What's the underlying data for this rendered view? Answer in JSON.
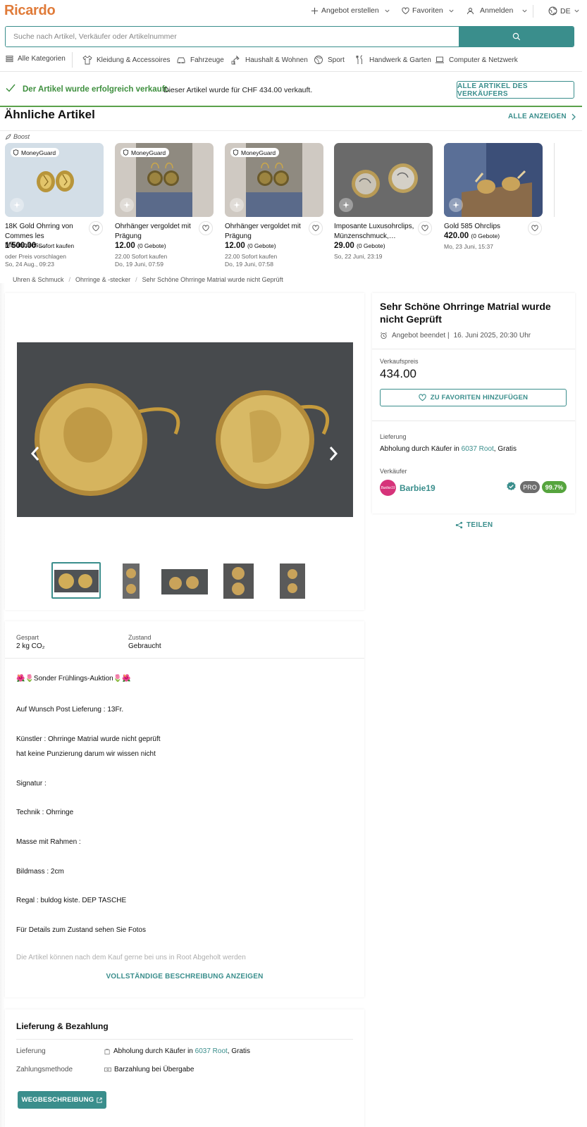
{
  "header": {
    "logo": "Ricardo",
    "create_offer": "Angebot erstellen",
    "favorites": "Favoriten",
    "login": "Anmelden",
    "language": "DE"
  },
  "search": {
    "placeholder": "Suche nach Artikel, Verkäufer oder Artikelnummer"
  },
  "categories": [
    {
      "label": "Alle Kategorien",
      "icon": "menu-icon"
    },
    {
      "label": "Kleidung & Accessoires",
      "icon": "shirt-icon"
    },
    {
      "label": "Fahrzeuge",
      "icon": "car-icon"
    },
    {
      "label": "Haushalt & Wohnen",
      "icon": "lamp-icon"
    },
    {
      "label": "Sport",
      "icon": "ball-icon"
    },
    {
      "label": "Handwerk & Garten",
      "icon": "tools-icon"
    },
    {
      "label": "Computer & Netzwerk",
      "icon": "laptop-icon"
    }
  ],
  "sold_banner": {
    "title": "Der Artikel wurde erfolgreich verkauft.",
    "text": "Dieser Artikel wurde für CHF 434.00 verkauft.",
    "button": "ALLE ARTIKEL DES VERKÄUFERS",
    "color": "#3e8f3e"
  },
  "similar": {
    "title": "Ähnliche Artikel",
    "show_all": "ALLE ANZEIGEN",
    "boost": "Boost",
    "cards": [
      {
        "badge": "MoneyGuard",
        "title": "18K Gold Ohrring von Commes les Milionaires…",
        "price": "1'500.00",
        "price_suffix": "Sofort kaufen",
        "meta1": "oder Preis vorschlagen",
        "meta2": "So, 24 Aug., 09:23"
      },
      {
        "badge": "MoneyGuard",
        "title": "Ohrhänger vergoldet mit Prägung",
        "price": "12.00",
        "price_suffix": "(0 Gebote)",
        "meta1": "22.00 Sofort kaufen",
        "meta2": "Do, 19 Juni, 07:59"
      },
      {
        "badge": "MoneyGuard",
        "title": "Ohrhänger vergoldet mit Prägung",
        "price": "12.00",
        "price_suffix": "(0 Gebote)",
        "meta1": "22.00 Sofort kaufen",
        "meta2": "Do, 19 Juni, 07:58"
      },
      {
        "badge": "",
        "title": "Imposante Luxusohrclips, Münzenschmuck,…",
        "price": "29.00",
        "price_suffix": "(0 Gebote)",
        "meta1": "So, 22 Juni, 23:19",
        "meta2": ""
      },
      {
        "badge": "",
        "title": "Gold 585 Ohrclips",
        "price": "420.00",
        "price_suffix": "(0 Gebote)",
        "meta1": "Mo, 23 Juni, 15:37",
        "meta2": ""
      }
    ]
  },
  "breadcrumb": [
    "Uhren & Schmuck",
    "Ohrringe & -stecker",
    "Sehr Schöne Ohrringe Matrial wurde nicht Geprüft"
  ],
  "item": {
    "title": "Sehr Schöne Ohrringe Matrial wurde nicht Geprüft",
    "ended_label": "Angebot beendet |",
    "ended_date": "16. Juni 2025, 20:30 Uhr",
    "price_label": "Verkaufspreis",
    "price": "434.00",
    "fav_button": "ZU FAVORITEN HINZUFÜGEN",
    "delivery_label": "Lieferung",
    "delivery_prefix": "Abholung durch Käufer in",
    "delivery_location": "6037 Root",
    "delivery_suffix": ", Gratis",
    "seller_label": "Verkäufer",
    "seller_name": "Barbie19",
    "seller_avatar_text": "Barbie19",
    "pro": "PRO",
    "rating": "99.7%",
    "share": "TEILEN"
  },
  "details": {
    "saved_label": "Gespart",
    "saved_value": "2 kg CO₂",
    "condition_label": "Zustand",
    "condition_value": "Gebraucht"
  },
  "description": {
    "lines": [
      "🌺🌷Sonder Frühlings-Auktion🌷🌺",
      "Auf Wunsch Post Lieferung : 13Fr.",
      "Künstler : Ohrringe Matrial wurde nicht geprüft",
      "hat keine Punzierung darum wir wissen nicht",
      "Signatur :",
      "Technik : Ohrringe",
      "Masse mit Rahmen :",
      "Bildmass : 2cm",
      "Regal : buldog kiste. DEP TASCHE",
      "Für Details zum Zustand sehen Sie Fotos"
    ],
    "faded": "Die Artikel können nach dem Kauf gerne bei uns in Root Abgeholt werden",
    "show_full": "VOLLSTÄNDIGE BESCHREIBUNG ANZEIGEN"
  },
  "payment": {
    "title": "Lieferung & Bezahlung",
    "delivery_label": "Lieferung",
    "delivery_prefix": "Abholung durch Käufer in",
    "delivery_location": "6037 Root",
    "delivery_suffix": ", Gratis",
    "method_label": "Zahlungsmethode",
    "method_value": "Barzahlung bei Übergabe",
    "directions_button": "WEGBESCHREIBUNG"
  },
  "colors": {
    "accent": "#3a8e8c",
    "brand": "#e07b39",
    "success": "#56a43e"
  }
}
